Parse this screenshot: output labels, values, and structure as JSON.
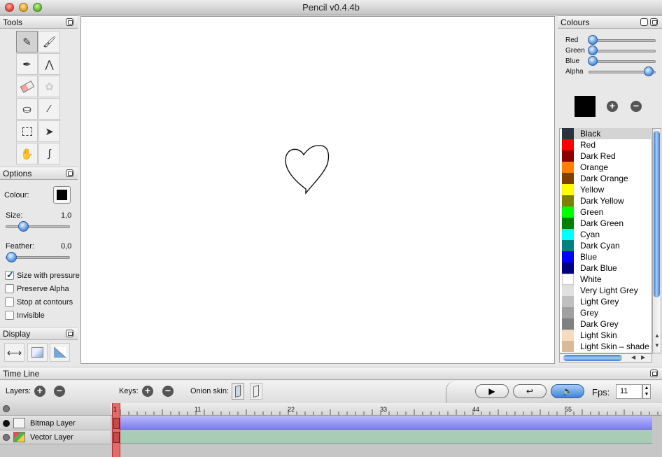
{
  "window": {
    "title": "Pencil v0.4.4b"
  },
  "tools_panel": {
    "title": "Tools"
  },
  "options_panel": {
    "title": "Options",
    "colour_label": "Colour:",
    "colour_value": "#000000",
    "size_label": "Size:",
    "size_value": "1,0",
    "feather_label": "Feather:",
    "feather_value": "0,0",
    "checkboxes": [
      {
        "label": "Size with pressure",
        "checked": true
      },
      {
        "label": "Preserve Alpha",
        "checked": false
      },
      {
        "label": "Stop at contours",
        "checked": false
      },
      {
        "label": "Invisible",
        "checked": false
      }
    ]
  },
  "display_panel": {
    "title": "Display"
  },
  "colours_panel": {
    "title": "Colours",
    "sliders": [
      {
        "label": "Red",
        "value": 0
      },
      {
        "label": "Green",
        "value": 0
      },
      {
        "label": "Blue",
        "value": 0
      },
      {
        "label": "Alpha",
        "value": 1
      }
    ],
    "current_colour": "#000000",
    "palette": [
      {
        "name": "Black",
        "color": "#2a3440",
        "selected": true
      },
      {
        "name": "Red",
        "color": "#ff0000"
      },
      {
        "name": "Dark Red",
        "color": "#8b0000"
      },
      {
        "name": "Orange",
        "color": "#ff8000"
      },
      {
        "name": "Dark Orange",
        "color": "#804000"
      },
      {
        "name": "Yellow",
        "color": "#ffff00"
      },
      {
        "name": "Dark Yellow",
        "color": "#808000"
      },
      {
        "name": "Green",
        "color": "#00ff00"
      },
      {
        "name": "Dark Green",
        "color": "#008000"
      },
      {
        "name": "Cyan",
        "color": "#00ffff"
      },
      {
        "name": "Dark Cyan",
        "color": "#008080"
      },
      {
        "name": "Blue",
        "color": "#0000ff"
      },
      {
        "name": "Dark Blue",
        "color": "#000080"
      },
      {
        "name": "White",
        "color": "#ffffff"
      },
      {
        "name": "Very Light Grey",
        "color": "#e0e0e0"
      },
      {
        "name": "Light Grey",
        "color": "#c0c0c0"
      },
      {
        "name": "Grey",
        "color": "#a0a0a0"
      },
      {
        "name": "Dark Grey",
        "color": "#808080"
      },
      {
        "name": "Light Skin",
        "color": "#f5dcc0"
      },
      {
        "name": "Light Skin – shade",
        "color": "#d8bc9a"
      }
    ]
  },
  "timeline": {
    "title": "Time Line",
    "layers_label": "Layers:",
    "keys_label": "Keys:",
    "onion_label": "Onion skin:",
    "fps_label": "Fps:",
    "fps_value": "11",
    "frame_numbers": [
      "1",
      "11",
      "22",
      "33",
      "44",
      "55"
    ],
    "current_frame": "1",
    "layers": [
      {
        "name": "Bitmap Layer",
        "color": "#8c8cf0"
      },
      {
        "name": "Vector Layer",
        "color": "#a8ccb4"
      }
    ]
  }
}
